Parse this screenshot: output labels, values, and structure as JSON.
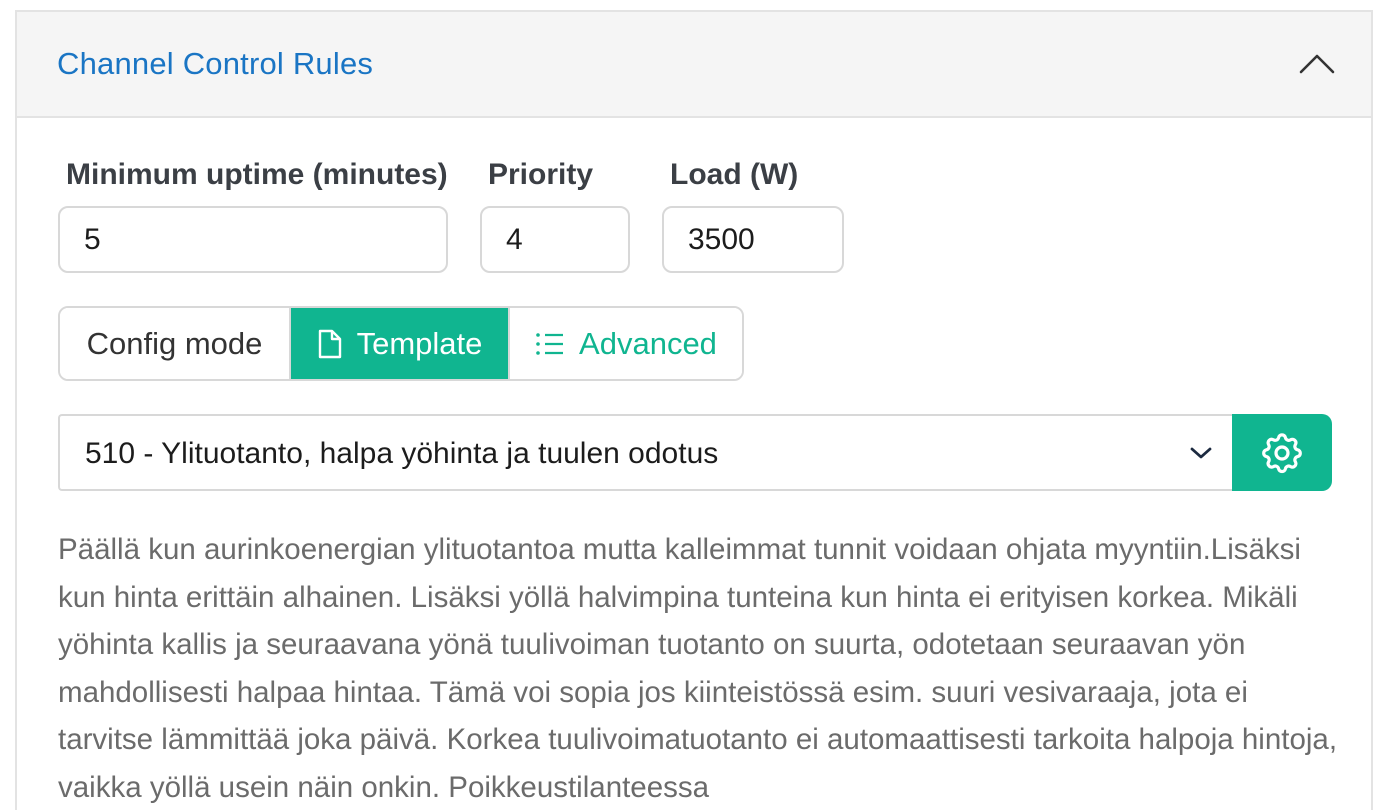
{
  "panel": {
    "title": "Channel Control Rules"
  },
  "fields": {
    "min_uptime": {
      "label": "Minimum uptime (minutes)",
      "value": "5"
    },
    "priority": {
      "label": "Priority",
      "value": "4"
    },
    "load": {
      "label": "Load (W)",
      "value": "3500"
    }
  },
  "config_mode": {
    "label": "Config mode",
    "options": [
      {
        "label": "Template",
        "icon": "document-icon",
        "selected": true
      },
      {
        "label": "Advanced",
        "icon": "list-icon",
        "selected": false
      }
    ]
  },
  "template_select": {
    "selected": "510 - Ylituotanto, halpa yöhinta ja tuulen odotus"
  },
  "description": "Päällä kun aurinkoenergian ylituotantoa mutta kalleimmat tunnit voidaan ohjata myyntiin.Lisäksi kun hinta erittäin alhainen. Lisäksi yöllä halvimpina tunteina kun hinta ei erityisen korkea. Mikäli yöhinta kallis ja seuraavana yönä tuulivoiman tuotanto on suurta, odotetaan seuraavan yön mahdollisesti halpaa hintaa. Tämä voi sopia jos kiinteistössä esim. suuri vesivaraaja, jota ei tarvitse lämmittää joka päivä. Korkea tuulivoimatuotanto ei automaattisesti tarkoita halpoja hintoja, vaikka yöllä usein näin onkin. Poikkeustilanteessa",
  "colors": {
    "accent": "#10b590",
    "title": "#1a75c4",
    "header_bg": "#f5f5f5",
    "border": "#e3e3e3"
  }
}
